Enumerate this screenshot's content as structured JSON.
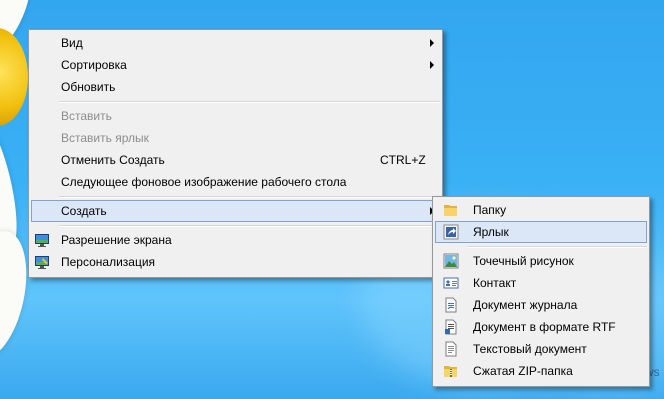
{
  "desktop": {
    "watermark": "ws",
    "accent": "#3ab0f5"
  },
  "context_menu": {
    "items": [
      {
        "label": "Вид",
        "submenu": true
      },
      {
        "label": "Сортировка",
        "submenu": true
      },
      {
        "label": "Обновить"
      },
      {
        "label": "Вставить",
        "disabled": true
      },
      {
        "label": "Вставить ярлык",
        "disabled": true
      },
      {
        "label": "Отменить Создать",
        "shortcut": "CTRL+Z"
      },
      {
        "label": "Следующее фоновое изображение рабочего стола"
      },
      {
        "label": "Создать",
        "submenu": true,
        "highlighted": true
      },
      {
        "label": "Разрешение экрана",
        "icon": "monitor-icon"
      },
      {
        "label": "Персонализация",
        "icon": "personalize-monitor-icon"
      }
    ]
  },
  "create_submenu": {
    "items": [
      {
        "label": "Папку",
        "icon": "folder-icon"
      },
      {
        "label": "Ярлык",
        "icon": "shortcut-icon",
        "highlighted": true
      },
      {
        "label": "Точечный рисунок",
        "icon": "bitmap-image-icon"
      },
      {
        "label": "Контакт",
        "icon": "contact-card-icon"
      },
      {
        "label": "Документ журнала",
        "icon": "journal-document-icon"
      },
      {
        "label": "Документ в формате RTF",
        "icon": "rtf-document-icon"
      },
      {
        "label": "Текстовый документ",
        "icon": "text-document-icon"
      },
      {
        "label": "Сжатая ZIP-папка",
        "icon": "zip-folder-icon"
      }
    ]
  }
}
